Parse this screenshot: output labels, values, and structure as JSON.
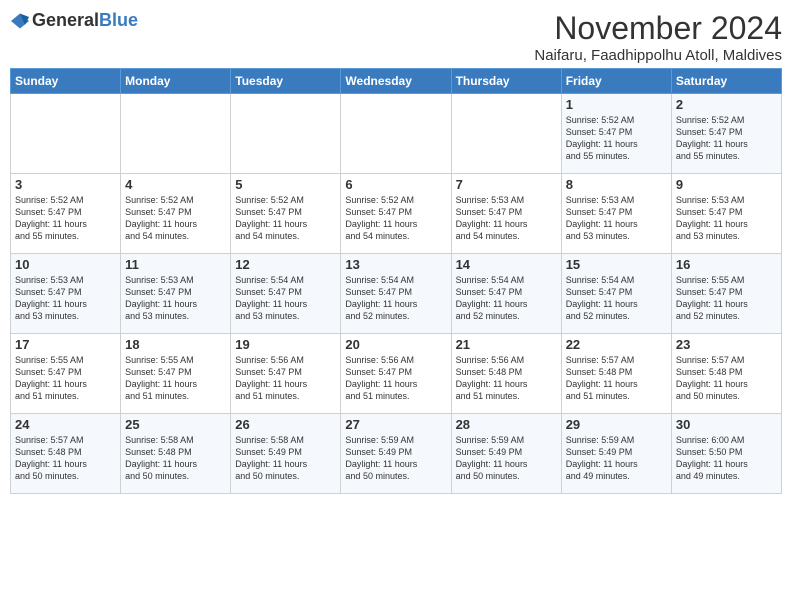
{
  "logo": {
    "general": "General",
    "blue": "Blue"
  },
  "title": "November 2024",
  "location": "Naifaru, Faadhippolhu Atoll, Maldives",
  "headers": [
    "Sunday",
    "Monday",
    "Tuesday",
    "Wednesday",
    "Thursday",
    "Friday",
    "Saturday"
  ],
  "weeks": [
    [
      {
        "day": "",
        "info": ""
      },
      {
        "day": "",
        "info": ""
      },
      {
        "day": "",
        "info": ""
      },
      {
        "day": "",
        "info": ""
      },
      {
        "day": "",
        "info": ""
      },
      {
        "day": "1",
        "info": "Sunrise: 5:52 AM\nSunset: 5:47 PM\nDaylight: 11 hours\nand 55 minutes."
      },
      {
        "day": "2",
        "info": "Sunrise: 5:52 AM\nSunset: 5:47 PM\nDaylight: 11 hours\nand 55 minutes."
      }
    ],
    [
      {
        "day": "3",
        "info": "Sunrise: 5:52 AM\nSunset: 5:47 PM\nDaylight: 11 hours\nand 55 minutes."
      },
      {
        "day": "4",
        "info": "Sunrise: 5:52 AM\nSunset: 5:47 PM\nDaylight: 11 hours\nand 54 minutes."
      },
      {
        "day": "5",
        "info": "Sunrise: 5:52 AM\nSunset: 5:47 PM\nDaylight: 11 hours\nand 54 minutes."
      },
      {
        "day": "6",
        "info": "Sunrise: 5:52 AM\nSunset: 5:47 PM\nDaylight: 11 hours\nand 54 minutes."
      },
      {
        "day": "7",
        "info": "Sunrise: 5:53 AM\nSunset: 5:47 PM\nDaylight: 11 hours\nand 54 minutes."
      },
      {
        "day": "8",
        "info": "Sunrise: 5:53 AM\nSunset: 5:47 PM\nDaylight: 11 hours\nand 53 minutes."
      },
      {
        "day": "9",
        "info": "Sunrise: 5:53 AM\nSunset: 5:47 PM\nDaylight: 11 hours\nand 53 minutes."
      }
    ],
    [
      {
        "day": "10",
        "info": "Sunrise: 5:53 AM\nSunset: 5:47 PM\nDaylight: 11 hours\nand 53 minutes."
      },
      {
        "day": "11",
        "info": "Sunrise: 5:53 AM\nSunset: 5:47 PM\nDaylight: 11 hours\nand 53 minutes."
      },
      {
        "day": "12",
        "info": "Sunrise: 5:54 AM\nSunset: 5:47 PM\nDaylight: 11 hours\nand 53 minutes."
      },
      {
        "day": "13",
        "info": "Sunrise: 5:54 AM\nSunset: 5:47 PM\nDaylight: 11 hours\nand 52 minutes."
      },
      {
        "day": "14",
        "info": "Sunrise: 5:54 AM\nSunset: 5:47 PM\nDaylight: 11 hours\nand 52 minutes."
      },
      {
        "day": "15",
        "info": "Sunrise: 5:54 AM\nSunset: 5:47 PM\nDaylight: 11 hours\nand 52 minutes."
      },
      {
        "day": "16",
        "info": "Sunrise: 5:55 AM\nSunset: 5:47 PM\nDaylight: 11 hours\nand 52 minutes."
      }
    ],
    [
      {
        "day": "17",
        "info": "Sunrise: 5:55 AM\nSunset: 5:47 PM\nDaylight: 11 hours\nand 51 minutes."
      },
      {
        "day": "18",
        "info": "Sunrise: 5:55 AM\nSunset: 5:47 PM\nDaylight: 11 hours\nand 51 minutes."
      },
      {
        "day": "19",
        "info": "Sunrise: 5:56 AM\nSunset: 5:47 PM\nDaylight: 11 hours\nand 51 minutes."
      },
      {
        "day": "20",
        "info": "Sunrise: 5:56 AM\nSunset: 5:47 PM\nDaylight: 11 hours\nand 51 minutes."
      },
      {
        "day": "21",
        "info": "Sunrise: 5:56 AM\nSunset: 5:48 PM\nDaylight: 11 hours\nand 51 minutes."
      },
      {
        "day": "22",
        "info": "Sunrise: 5:57 AM\nSunset: 5:48 PM\nDaylight: 11 hours\nand 51 minutes."
      },
      {
        "day": "23",
        "info": "Sunrise: 5:57 AM\nSunset: 5:48 PM\nDaylight: 11 hours\nand 50 minutes."
      }
    ],
    [
      {
        "day": "24",
        "info": "Sunrise: 5:57 AM\nSunset: 5:48 PM\nDaylight: 11 hours\nand 50 minutes."
      },
      {
        "day": "25",
        "info": "Sunrise: 5:58 AM\nSunset: 5:48 PM\nDaylight: 11 hours\nand 50 minutes."
      },
      {
        "day": "26",
        "info": "Sunrise: 5:58 AM\nSunset: 5:49 PM\nDaylight: 11 hours\nand 50 minutes."
      },
      {
        "day": "27",
        "info": "Sunrise: 5:59 AM\nSunset: 5:49 PM\nDaylight: 11 hours\nand 50 minutes."
      },
      {
        "day": "28",
        "info": "Sunrise: 5:59 AM\nSunset: 5:49 PM\nDaylight: 11 hours\nand 50 minutes."
      },
      {
        "day": "29",
        "info": "Sunrise: 5:59 AM\nSunset: 5:49 PM\nDaylight: 11 hours\nand 49 minutes."
      },
      {
        "day": "30",
        "info": "Sunrise: 6:00 AM\nSunset: 5:50 PM\nDaylight: 11 hours\nand 49 minutes."
      }
    ]
  ]
}
